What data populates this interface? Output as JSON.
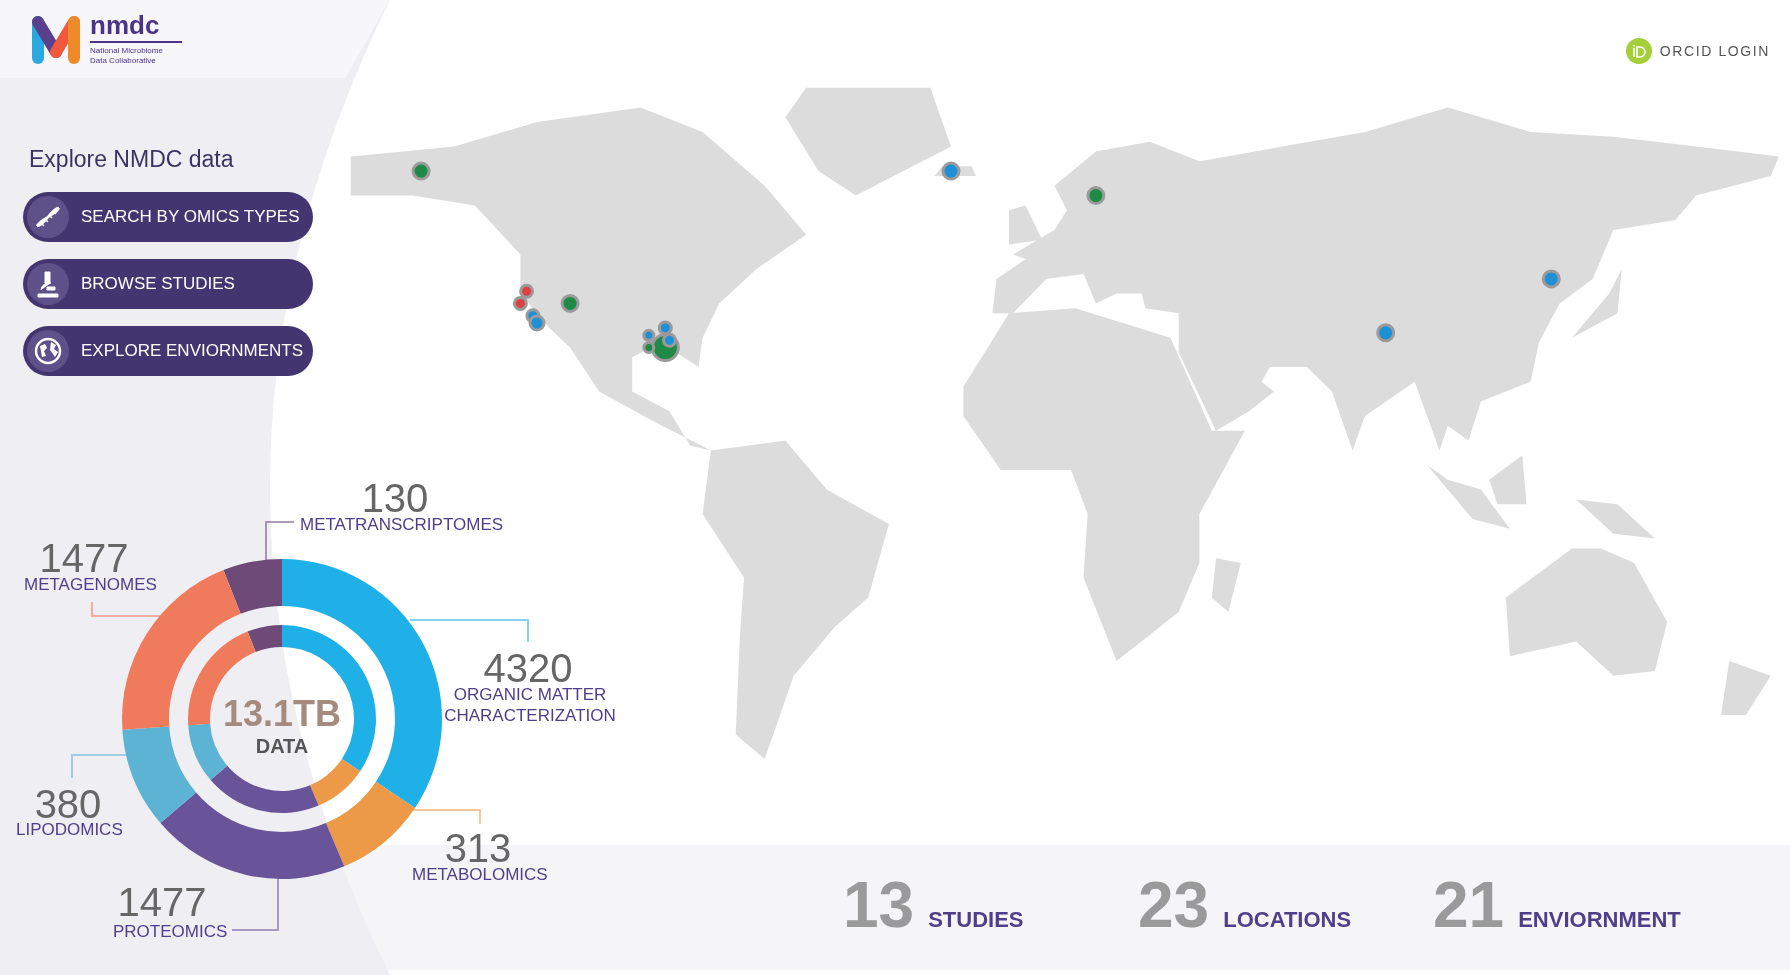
{
  "header": {
    "logo_text": "nmdc",
    "subtitle_lines": [
      "National Microbiome",
      "Data Collaborative"
    ],
    "login": "ORCID LOGIN"
  },
  "explore": {
    "title": "Explore NMDC data",
    "buttons": [
      "SEARCH BY OMICS TYPES",
      "BROWSE STUDIES",
      "EXPLORE ENVIORNMENTS"
    ]
  },
  "donut_center": {
    "value": "13.1TB",
    "label": "DATA"
  },
  "omics": [
    {
      "count": "130",
      "label": "METATRANSCRIPTOMES",
      "color": "#6e4a78"
    },
    {
      "count": "1477",
      "label": "METAGENOMES",
      "color": "#f07a5c"
    },
    {
      "count": "4320",
      "label": "ORGANIC MATTER CHARACTERIZATION",
      "color": "#1fb0e8"
    },
    {
      "count": "380",
      "label": "LIPODOMICS",
      "color": "#5db3d3"
    },
    {
      "count": "313",
      "label": "METABOLOMICS",
      "color": "#ec9a48"
    },
    {
      "count": "1477",
      "label": "PROTEOMICS",
      "color": "#6a5499"
    }
  ],
  "stats": [
    {
      "count": "13",
      "label": "STUDIES"
    },
    {
      "count": "23",
      "label": "LOCATIONS"
    },
    {
      "count": "21",
      "label": "ENVIORNMENT"
    }
  ]
}
